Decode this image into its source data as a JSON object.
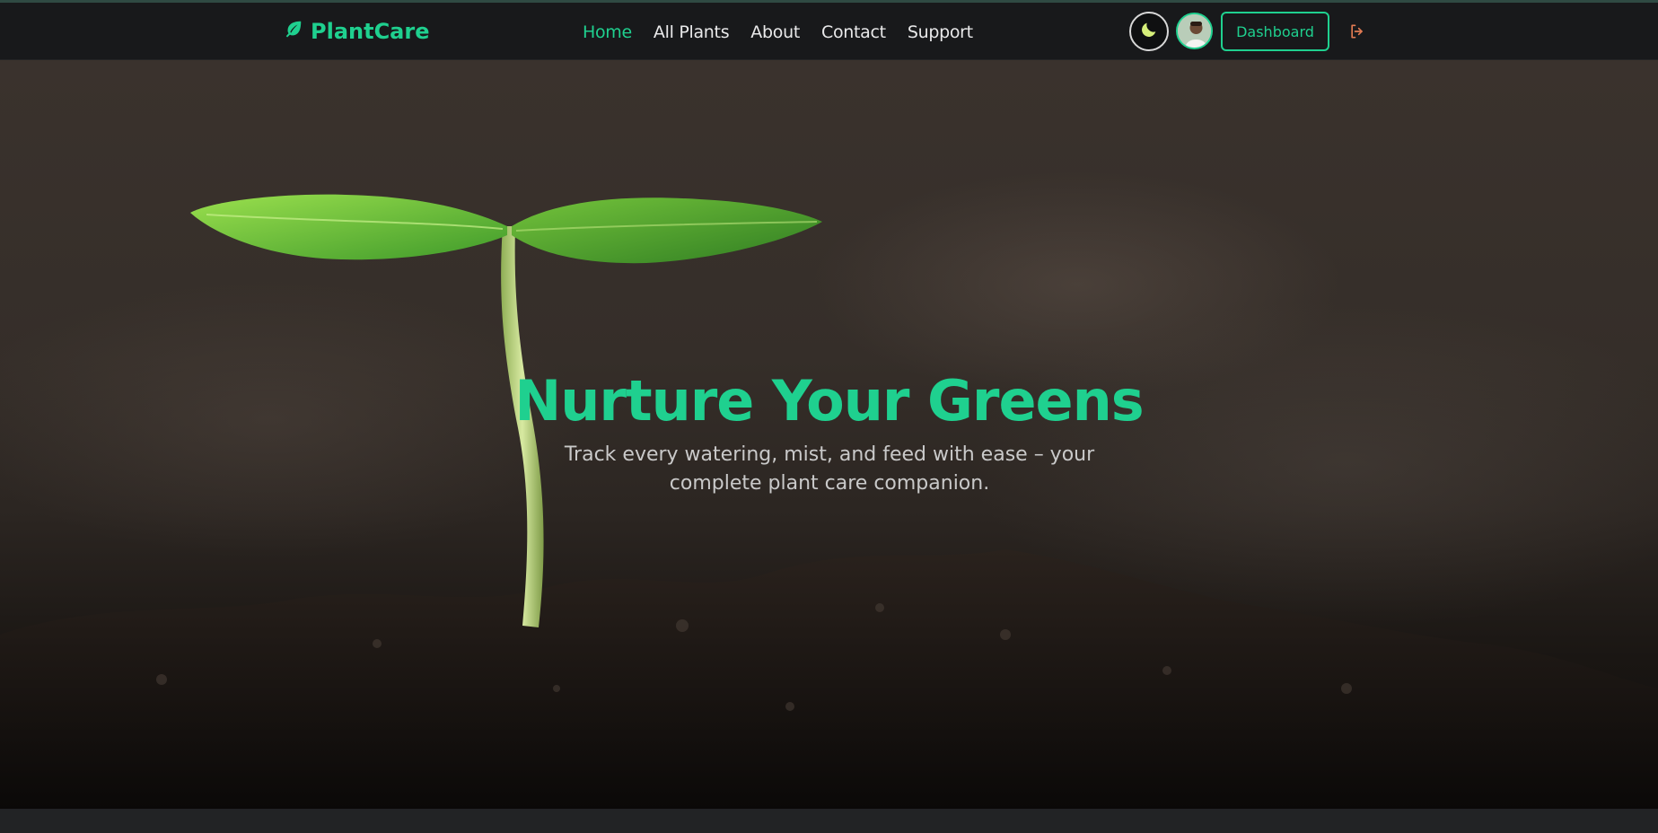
{
  "brand": {
    "name": "PlantCare",
    "icon": "leaf-icon",
    "color": "#1fd08f"
  },
  "nav": {
    "links": [
      {
        "label": "Home",
        "active": true
      },
      {
        "label": "All Plants",
        "active": false
      },
      {
        "label": "About",
        "active": false
      },
      {
        "label": "Contact",
        "active": false
      },
      {
        "label": "Support",
        "active": false
      }
    ]
  },
  "actions": {
    "theme_icon": "moon-icon",
    "avatar_icon": "avatar",
    "dashboard_label": "Dashboard",
    "logout_icon": "logout-icon"
  },
  "hero": {
    "title": "Nurture Your Greens",
    "subtitle": "Track every watering, mist, and feed with ease – your complete plant care companion."
  },
  "colors": {
    "accent": "#1fd08f",
    "navbar": "#18191b",
    "moon": "#d6ef7a"
  }
}
